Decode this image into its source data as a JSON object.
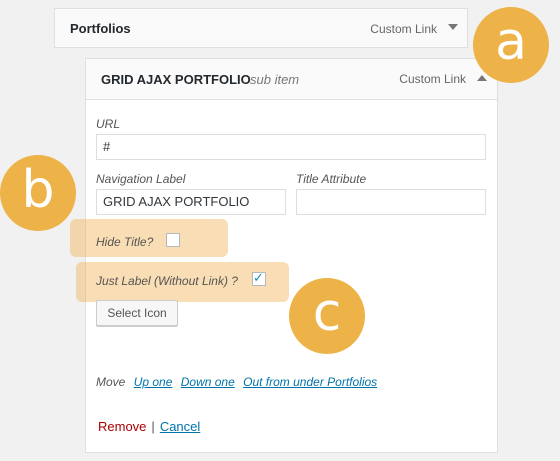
{
  "parent_item": {
    "title": "Portfolios",
    "type": "Custom Link"
  },
  "child_item": {
    "title": "GRID AJAX PORTFOLIO",
    "subitem_label": "sub item",
    "type": "Custom Link",
    "url_label": "URL",
    "url_value": "#",
    "nav_label": "Navigation Label",
    "nav_value": "GRID AJAX PORTFOLIO",
    "title_attr_label": "Title Attribute",
    "title_attr_value": "",
    "hide_title_label": "Hide Title?",
    "hide_title_checked": false,
    "just_label_label": "Just Label (Without Link) ?",
    "just_label_checked": true,
    "select_icon_label": "Select Icon",
    "move_label": "Move",
    "move_links": [
      "Up one",
      "Down one",
      "Out from under Portfolios"
    ],
    "remove_label": "Remove",
    "separator": "|",
    "cancel_label": "Cancel"
  },
  "badges": {
    "a": "a",
    "b": "b",
    "c": "c"
  },
  "colors": {
    "badge": "#eeb348",
    "highlight": "#f0ad4e",
    "link": "#0073aa",
    "remove": "#aa0000"
  }
}
